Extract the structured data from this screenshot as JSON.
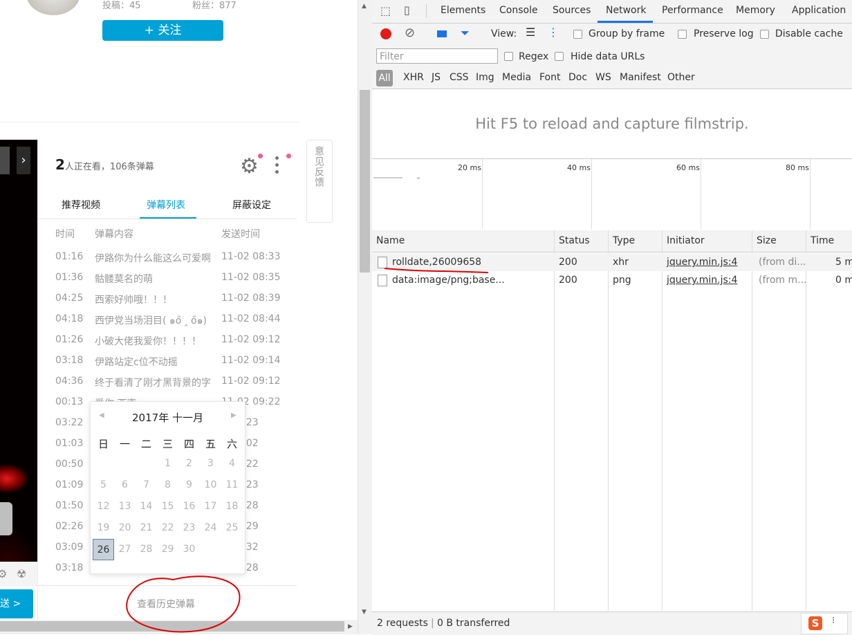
{
  "profile": {
    "posts_label": "投稿：45",
    "fans_label": "粉丝：877",
    "follow_button": "+ 关注"
  },
  "danmaku_panel": {
    "watching_count": "2",
    "watching_suffix": "人正在看，106条弹幕",
    "tabs": [
      "推荐视频",
      "弹幕列表",
      "屏蔽设定"
    ],
    "active_tab": "弹幕列表",
    "headers": {
      "time": "时间",
      "content": "弹幕内容",
      "sent": "发送时间"
    },
    "rows": [
      {
        "time": "01:16",
        "content": "伊路你为什么能这么可爱啊",
        "sent": "11-02 08:33"
      },
      {
        "time": "01:36",
        "content": "骷髅莫名的萌",
        "sent": "11-02 08:35"
      },
      {
        "time": "04:25",
        "content": "西索好帅哦！！！",
        "sent": "11-02 08:39"
      },
      {
        "time": "04:18",
        "content": "西伊党当场泪目( ๑ő ‸ ő๑)",
        "sent": "11-02 08:44"
      },
      {
        "time": "01:26",
        "content": "小破大佬我爱你！！！！",
        "sent": "11-02 09:12"
      },
      {
        "time": "03:18",
        "content": "伊路站定c位不动摇",
        "sent": "11-02 09:14"
      },
      {
        "time": "04:36",
        "content": "终于看清了刚才黑背景的字",
        "sent": "11-02 09:12"
      },
      {
        "time": "00:13",
        "content": "爱你 西索",
        "sent": "11-02 09:22"
      },
      {
        "time": "03:22",
        "content": "",
        "sent": "2 12:23"
      },
      {
        "time": "01:03",
        "content": "",
        "sent": "2 18:02"
      },
      {
        "time": "00:50",
        "content": "",
        "sent": "2 18:22"
      },
      {
        "time": "01:09",
        "content": "",
        "sent": "2 18:23"
      },
      {
        "time": "01:50",
        "content": "",
        "sent": "2 18:28"
      },
      {
        "time": "02:26",
        "content": "",
        "sent": "2 18:29"
      },
      {
        "time": "03:09",
        "content": "",
        "sent": "2 18:32"
      },
      {
        "time": "03:18",
        "content": "",
        "sent": "2 18:28"
      }
    ],
    "history_button": "查看历史弹幕",
    "send_button": "送 >"
  },
  "feedback_label": "意见反馈",
  "calendar": {
    "title": "2017年  十一月",
    "weekdays": [
      "日",
      "一",
      "二",
      "三",
      "四",
      "五",
      "六"
    ],
    "weeks": [
      [
        "",
        "",
        "",
        "1",
        "2",
        "3",
        "4"
      ],
      [
        "5",
        "6",
        "7",
        "8",
        "9",
        "10",
        "11"
      ],
      [
        "12",
        "13",
        "14",
        "15",
        "16",
        "17",
        "18"
      ],
      [
        "19",
        "20",
        "21",
        "22",
        "23",
        "24",
        "25"
      ],
      [
        "26",
        "27",
        "28",
        "29",
        "30",
        "",
        ""
      ]
    ],
    "selected_day": "26"
  },
  "devtools": {
    "tabs": [
      "Elements",
      "Console",
      "Sources",
      "Network",
      "Performance",
      "Memory",
      "Application"
    ],
    "active_tab": "Network",
    "view_label": "View:",
    "group_by_frame": "Group by frame",
    "preserve_log": "Preserve log",
    "disable_cache": "Disable cache",
    "filter_placeholder": "Filter",
    "regex": "Regex",
    "hide_data_urls": "Hide data URLs",
    "type_filters": [
      "All",
      "XHR",
      "JS",
      "CSS",
      "Img",
      "Media",
      "Font",
      "Doc",
      "WS",
      "Manifest",
      "Other"
    ],
    "filmstrip_hint": "Hit F5 to reload and capture filmstrip.",
    "timeline_ticks": [
      "20 ms",
      "40 ms",
      "60 ms",
      "80 ms"
    ],
    "columns": [
      "Name",
      "Status",
      "Type",
      "Initiator",
      "Size",
      "Time"
    ],
    "requests": [
      {
        "name": "rolldate,26009658",
        "status": "200",
        "type": "xhr",
        "initiator": "jquery.min.js:4",
        "size": "(from di...",
        "time": "5 m"
      },
      {
        "name": "data:image/png;base...",
        "status": "200",
        "type": "png",
        "initiator": "jquery.min.js:4",
        "size": "(from m...",
        "time": "0 m"
      }
    ],
    "summary_requests": "2 requests",
    "summary_transferred": "0 B transferred"
  },
  "colors": {
    "accent_blue": "#00a1d6",
    "annotation_red": "#e00000",
    "devtools_active": "#1a73e8"
  }
}
